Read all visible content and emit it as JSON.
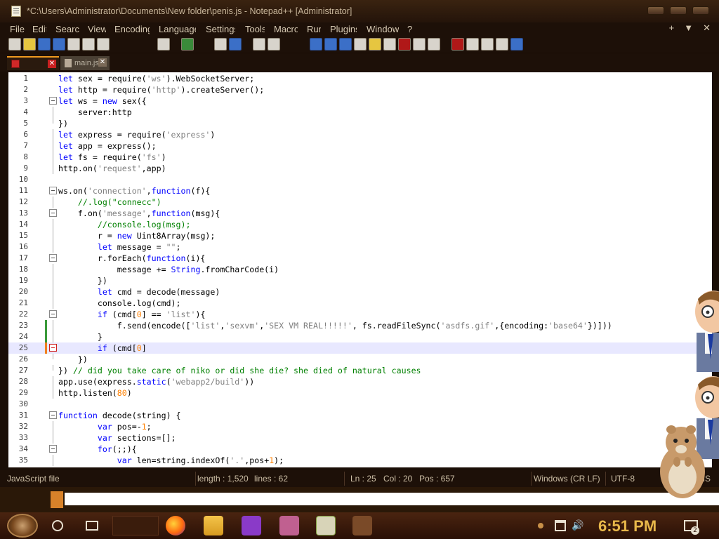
{
  "window": {
    "title": "*C:\\Users\\Administrator\\Documents\\New folder\\penis.js - Notepad++ [Administrator]"
  },
  "menu": {
    "items": [
      "File",
      "Edit",
      "Search",
      "View",
      "Encoding",
      "Language",
      "Settings",
      "Tools",
      "Macro",
      "Run",
      "Plugins",
      "Window",
      "?"
    ],
    "right": [
      "+",
      "▼",
      "✕"
    ]
  },
  "tabs": [
    {
      "label": "",
      "active": true
    },
    {
      "label": "main.js",
      "active": false
    }
  ],
  "code_lines": [
    {
      "n": "1",
      "html": "<span class='kw'>let</span> sex = require(<span class='str'>'ws'</span>).WebSocketServer;"
    },
    {
      "n": "2",
      "html": "<span class='kw'>let</span> http = require(<span class='str'>'http'</span>).createServer();"
    },
    {
      "n": "3",
      "html": "<span class='kw'>let</span> ws = <span class='kw'>new</span> sex({"
    },
    {
      "n": "4",
      "html": "    server:http"
    },
    {
      "n": "5",
      "html": "})"
    },
    {
      "n": "6",
      "html": "<span class='kw'>let</span> express = require(<span class='str'>'express'</span>)"
    },
    {
      "n": "7",
      "html": "<span class='kw'>let</span> app = express();"
    },
    {
      "n": "8",
      "html": "<span class='kw'>let</span> fs = require(<span class='str'>'fs'</span>)"
    },
    {
      "n": "9",
      "html": "http.on(<span class='str'>'request'</span>,app)"
    },
    {
      "n": "10",
      "html": ""
    },
    {
      "n": "11",
      "html": "ws.on(<span class='str'>'connection'</span>,<span class='kw'>function</span>(f){"
    },
    {
      "n": "12",
      "html": "    <span class='cmt'>//.log(\"connecc\")</span>"
    },
    {
      "n": "13",
      "html": "    f.on(<span class='str'>'message'</span>,<span class='kw'>function</span>(msg){"
    },
    {
      "n": "14",
      "html": "        <span class='cmt'>//console.log(msg);</span>"
    },
    {
      "n": "15",
      "html": "        r = <span class='kw'>new</span> Uint8Array(msg);"
    },
    {
      "n": "16",
      "html": "        <span class='kw'>let</span> message = <span class='str'>\"\"</span>;"
    },
    {
      "n": "17",
      "html": "        r.forEach(<span class='kw'>function</span>(i){"
    },
    {
      "n": "18",
      "html": "            message += <span class='kw'>String</span>.fromCharCode(i)"
    },
    {
      "n": "19",
      "html": "        })"
    },
    {
      "n": "20",
      "html": "        <span class='kw'>let</span> cmd = decode(message)"
    },
    {
      "n": "21",
      "html": "        console.log(cmd);"
    },
    {
      "n": "22",
      "html": "        <span class='kw'>if</span> (cmd[<span class='num'>0</span>] == <span class='str'>'list'</span>){"
    },
    {
      "n": "23",
      "html": "            f.send(encode([<span class='str'>'list'</span>,<span class='str'>'sexvm'</span>,<span class='str'>'SEX VM REAL!!!!!'</span>, fs.readFileSync(<span class='str'>'asdfs.gif'</span>,{encoding:<span class='str'>'base64'</span>})]))"
    },
    {
      "n": "24",
      "html": "        }"
    },
    {
      "n": "25",
      "html": "        <span class='kw'>if</span> (cmd[<span class='num'>0</span>]"
    },
    {
      "n": "26",
      "html": "    })"
    },
    {
      "n": "27",
      "html": "}) <span class='cmt'>// did you take care of niko or did she die? she died of natural causes</span>"
    },
    {
      "n": "28",
      "html": "app.use(express.<span class='kw'>static</span>(<span class='str'>'webapp2/build'</span>))"
    },
    {
      "n": "29",
      "html": "http.listen(<span class='num'>80</span>)"
    },
    {
      "n": "30",
      "html": ""
    },
    {
      "n": "31",
      "html": "<span class='kw'>function</span> decode(string) {"
    },
    {
      "n": "32",
      "html": "        <span class='kw'>var</span> pos=-<span class='num'>1</span>;"
    },
    {
      "n": "33",
      "html": "        <span class='kw'>var</span> sections=[];"
    },
    {
      "n": "34",
      "html": "        <span class='kw'>for</span>(;;){"
    },
    {
      "n": "35",
      "html": "            <span class='kw'>var</span> len=string.indexOf(<span class='str'>'.'</span>,pos+<span class='num'>1</span>);"
    }
  ],
  "status": {
    "file_type": "JavaScript file",
    "length": "length : 1,520",
    "lines": "lines : 62",
    "ln": "Ln : 25",
    "col": "Col : 20",
    "pos": "Pos : 657",
    "eol": "Windows (CR LF)",
    "encoding": "UTF-8",
    "mode": "INS"
  },
  "taskbar": {
    "clock": "6:51 PM",
    "notifications": "2"
  },
  "colors": {
    "accent": "#f09a20",
    "keyword": "#0000ff",
    "string": "#808080",
    "comment": "#008000",
    "number": "#ff8000"
  }
}
